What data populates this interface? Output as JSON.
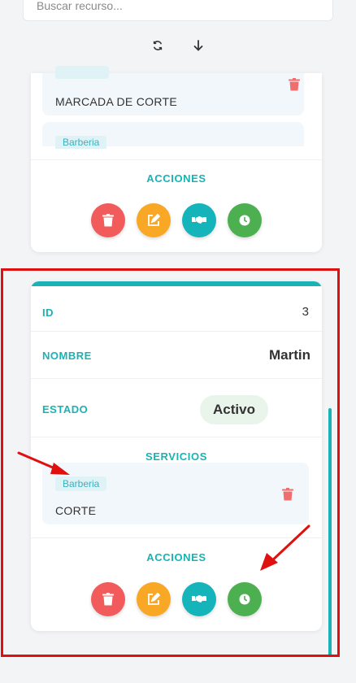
{
  "search": {
    "placeholder": "Buscar recurso..."
  },
  "toolbar": {
    "refresh_icon": "refresh-icon",
    "download_icon": "arrow-down-icon"
  },
  "cards": [
    {
      "services": [
        {
          "category": "",
          "name": "MARCADA DE CORTE"
        },
        {
          "category": "Barberia",
          "name": ""
        }
      ],
      "actions_label": "ACCIONES"
    },
    {
      "fields": [
        {
          "label": "ID",
          "value": "3"
        },
        {
          "label": "NOMBRE",
          "value": "Martin"
        },
        {
          "label": "ESTADO",
          "value": "Activo"
        }
      ],
      "services_label": "SERVICIOS",
      "services": [
        {
          "category": "Barberia",
          "name": "CORTE"
        }
      ],
      "actions_label": "ACCIONES"
    }
  ],
  "actions": [
    {
      "name": "delete",
      "icon": "trash-icon",
      "color": "#f15b5b"
    },
    {
      "name": "edit",
      "icon": "edit-icon",
      "color": "#f9a825"
    },
    {
      "name": "assign",
      "icon": "handshake-icon",
      "color": "#14b4ba"
    },
    {
      "name": "schedule",
      "icon": "clock-icon",
      "color": "#4caf50"
    }
  ],
  "colors": {
    "accent": "#19b3b6",
    "highlight": "#e01010",
    "trash": "#ef6f6f"
  }
}
